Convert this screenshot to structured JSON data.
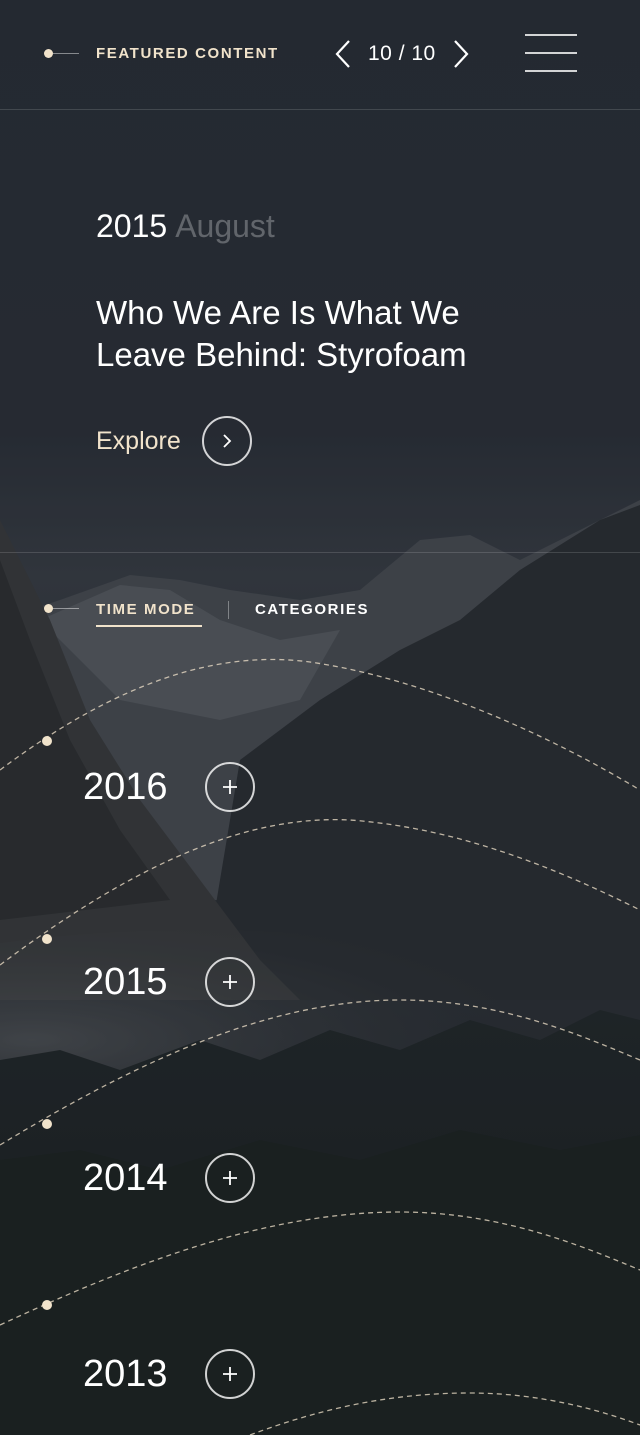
{
  "header": {
    "section_label": "FEATURED CONTENT",
    "pager": {
      "current": 10,
      "total": 10,
      "text": "10 / 10"
    }
  },
  "featured": {
    "year": "2015",
    "month": "August",
    "title": "Who We Are Is What We Leave Behind: Styrofoam",
    "explore_label": "Explore"
  },
  "modes": {
    "time_label": "TIME MODE",
    "categories_label": "CATEGORIES",
    "active": "time"
  },
  "timeline": {
    "years": [
      {
        "label": "2016"
      },
      {
        "label": "2015"
      },
      {
        "label": "2014"
      },
      {
        "label": "2013"
      }
    ]
  },
  "colors": {
    "accent": "#f1e3cb",
    "text": "#ffffff"
  },
  "icons": {
    "prev": "chevron-left-icon",
    "next": "chevron-right-icon",
    "menu": "hamburger-menu-icon",
    "explore": "chevron-right-icon",
    "expand": "plus-icon"
  }
}
